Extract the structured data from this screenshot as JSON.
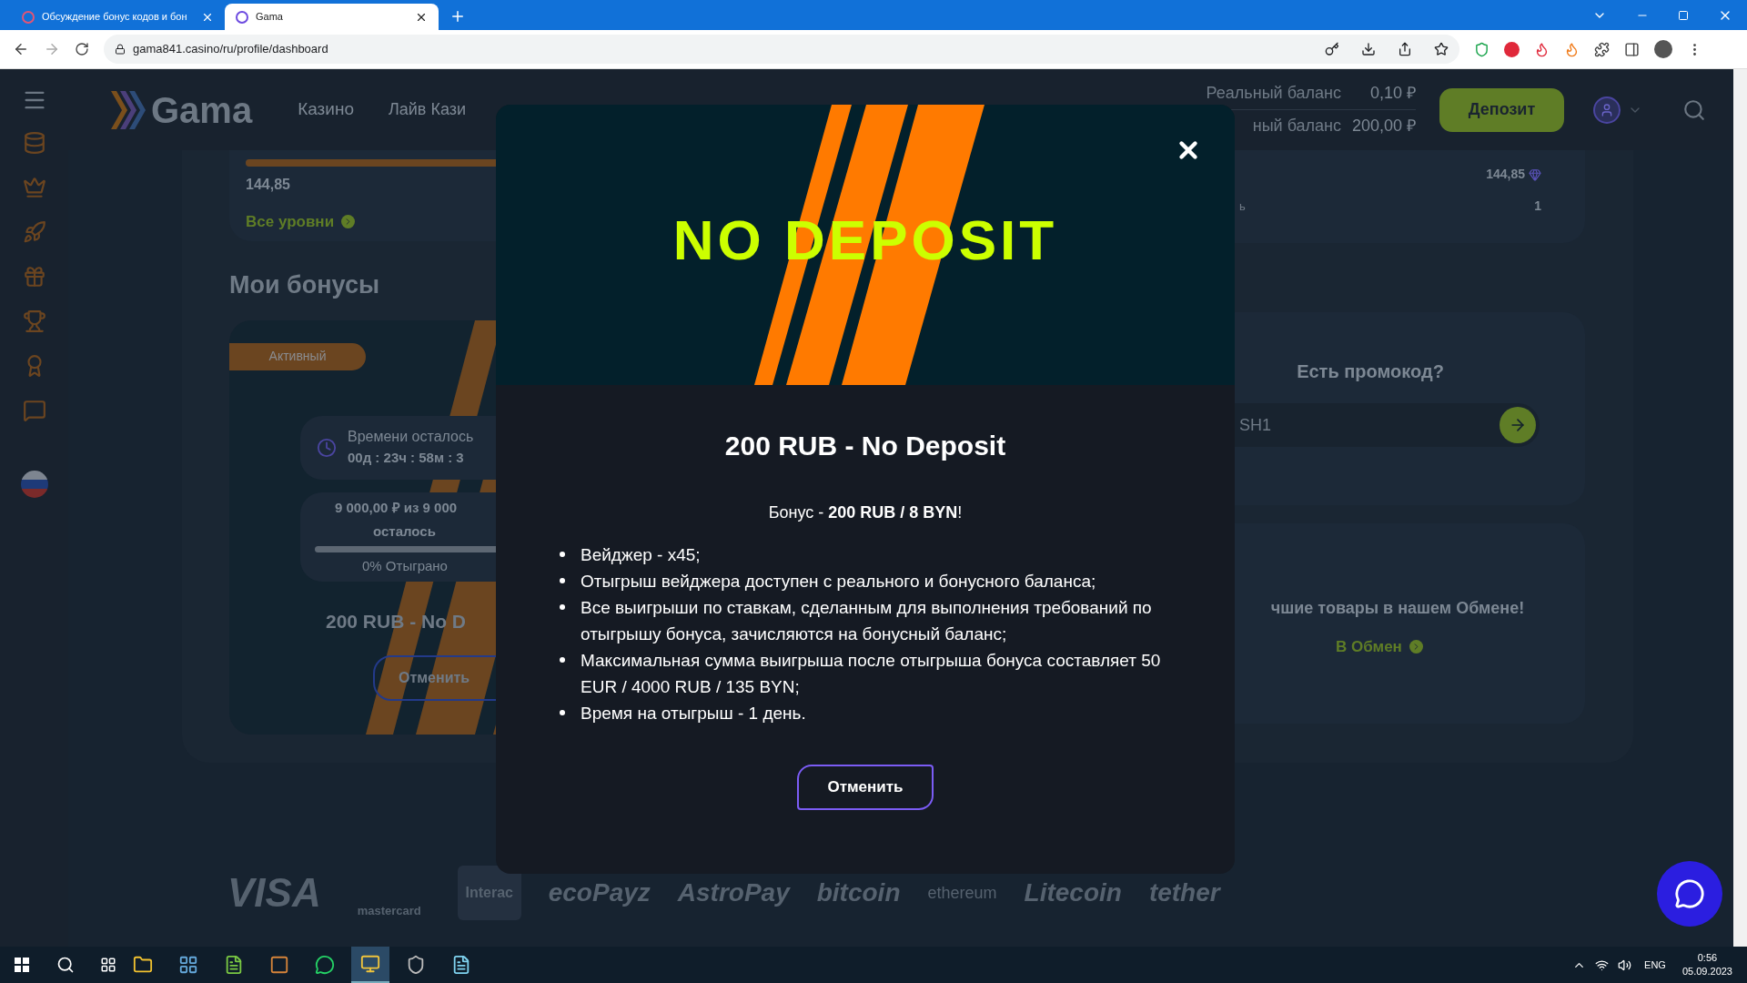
{
  "browser": {
    "tabs": [
      {
        "title": "Обсуждение бонус кодов и бон",
        "selected": false
      },
      {
        "title": "Gama",
        "selected": true
      }
    ],
    "address": "gama841.casino/ru/profile/dashboard"
  },
  "header": {
    "logo": "Gama",
    "nav": [
      "Казино",
      "Лайв Кази"
    ],
    "balances": [
      {
        "label": "Реальный баланс",
        "value": "0,10 ₽"
      },
      {
        "label": "ный баланс",
        "value": "200,00 ₽"
      }
    ],
    "deposit_button": "Депозит"
  },
  "levels_card": {
    "level": 1,
    "value": "144,85",
    "link": "Все уровни"
  },
  "bonuses": {
    "title": "Мои бонусы",
    "card": {
      "status": "Активный",
      "timer_label": "Времени осталось",
      "timer": "00д : 23ч : 58м : 3",
      "wager": "9 000,00 ₽ из 9 000",
      "remaining": "осталось",
      "level": 0,
      "progress_text": "0% Отыграно",
      "name": "200 RUB - No D",
      "cancel": "Отменить"
    }
  },
  "stats_card": {
    "rows": [
      {
        "label": "",
        "value": "144,85"
      },
      {
        "label": "ь",
        "value": "1"
      }
    ]
  },
  "promo": {
    "title": "Есть промокод?",
    "value": "SH1"
  },
  "exchange": {
    "text": "чшие товары в нашем Обмене!",
    "link": "В Обмен"
  },
  "payments": [
    "VISA",
    "mastercard",
    "Interac",
    "ecoPayz",
    "AstroPay",
    "bitcoin",
    "ethereum",
    "Litecoin",
    "tether"
  ],
  "modal": {
    "banner": "NO DEPOSIT",
    "title": "200 RUB - No Deposit",
    "intro": "Бонус - **200 RUB / 8 BYN**!",
    "rules": [
      "Вейджер - x45;",
      "Отыгрыш вейджера доступен с реального и бонусного баланса;",
      "Все выигрыши по ставкам, сделанным для выполнения требований по отыгрышу бонуса, зачисляются на бонусный баланс;",
      "Максимальная сумма выигрыша после отыгрыша бонуса составляет 50 EUR / 4000 RUB / 135 BYN;",
      "Время на отыгрыш - 1 день."
    ],
    "cancel": "Отменить"
  },
  "taskbar": {
    "language": "ENG",
    "time": "0:56",
    "date": "05.09.2023"
  }
}
